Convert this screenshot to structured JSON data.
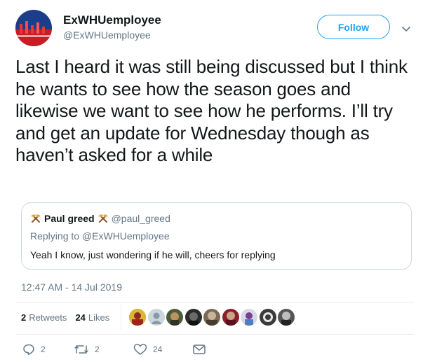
{
  "author": {
    "name": "ExWHUemployee",
    "handle": "@ExWHUemployee",
    "follow_label": "Follow"
  },
  "tweet": {
    "text": "Last I heard it was still being discussed but I think he wants to see how the season goes and likewise we want to see how he performs. I’ll try and get an update for Wednesday though as haven’t asked for a while",
    "timestamp": "12:47 AM - 14 Jul 2019"
  },
  "quoted": {
    "name": "Paul greed",
    "handle": "@paul_greed",
    "replying_prefix": "Replying to ",
    "replying_to": "@ExWHUemployee",
    "text": "Yeah I know, just wondering if he will, cheers for replying"
  },
  "stats": {
    "retweets_count": "2",
    "retweets_label": "Retweets",
    "likes_count": "24",
    "likes_label": "Likes"
  },
  "actions": {
    "reply_count": "2",
    "retweet_count": "2",
    "like_count": "24"
  },
  "colors": {
    "accent": "#1da1f2",
    "secondary_text": "#657786",
    "border": "#ccd6dd"
  },
  "icons": [
    "chevron-down-icon",
    "crossed-hammers-icon",
    "reply-icon",
    "retweet-icon",
    "heart-icon",
    "direct-message-icon"
  ]
}
